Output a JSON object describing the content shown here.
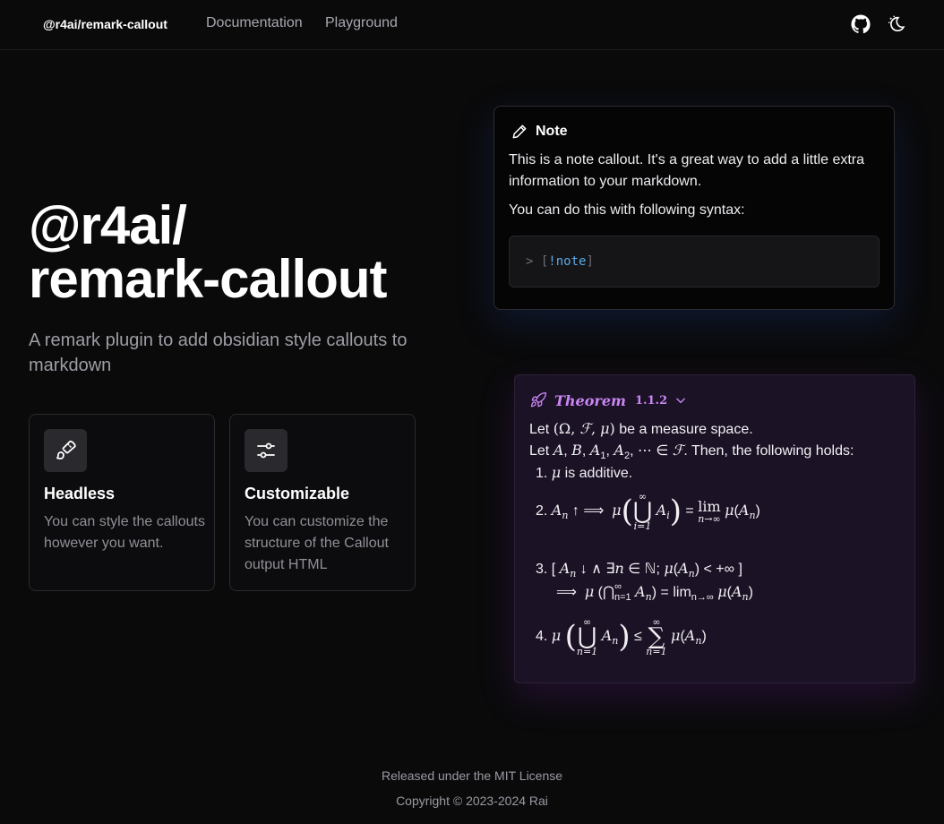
{
  "nav": {
    "brand": "@r4ai/remark-callout",
    "links": [
      "Documentation",
      "Playground"
    ],
    "icons": [
      "github-icon",
      "theme-toggle-icon"
    ]
  },
  "hero": {
    "title_line1": "@r4ai/",
    "title_line2": "remark-callout",
    "tagline": "A remark plugin to add obsidian style callouts to markdown"
  },
  "features": [
    {
      "icon": "paintbrush-icon",
      "title": "Headless",
      "description": "You can style the callouts however you want."
    },
    {
      "icon": "sliders-icon",
      "title": "Customizable",
      "description": "You can customize the structure of the Callout output HTML"
    }
  ],
  "note_callout": {
    "icon": "pencil-icon",
    "title": "Note",
    "body1": "This is a note callout. It's a great way to add a little extra information to your markdown.",
    "body2": "You can do this with following syntax:",
    "code_prefix": ">",
    "code_keyword": "!note"
  },
  "theorem_callout": {
    "icon": "rocket-icon",
    "title": "Theorem",
    "number": "1.1.2",
    "chevron": "chevron-down-icon",
    "line1_text": "be a measure space.",
    "line2_text": ". Then, the following holds:",
    "item1_text": "is additive."
  },
  "footer": {
    "license": "Released under the MIT License",
    "copyright": "Copyright © 2023-2024 Rai"
  },
  "colors": {
    "background": "#0a0a0b",
    "theorem_accent": "#c986f4",
    "theorem_bg": "#1c1226",
    "code_keyword": "#5aa9e6"
  }
}
